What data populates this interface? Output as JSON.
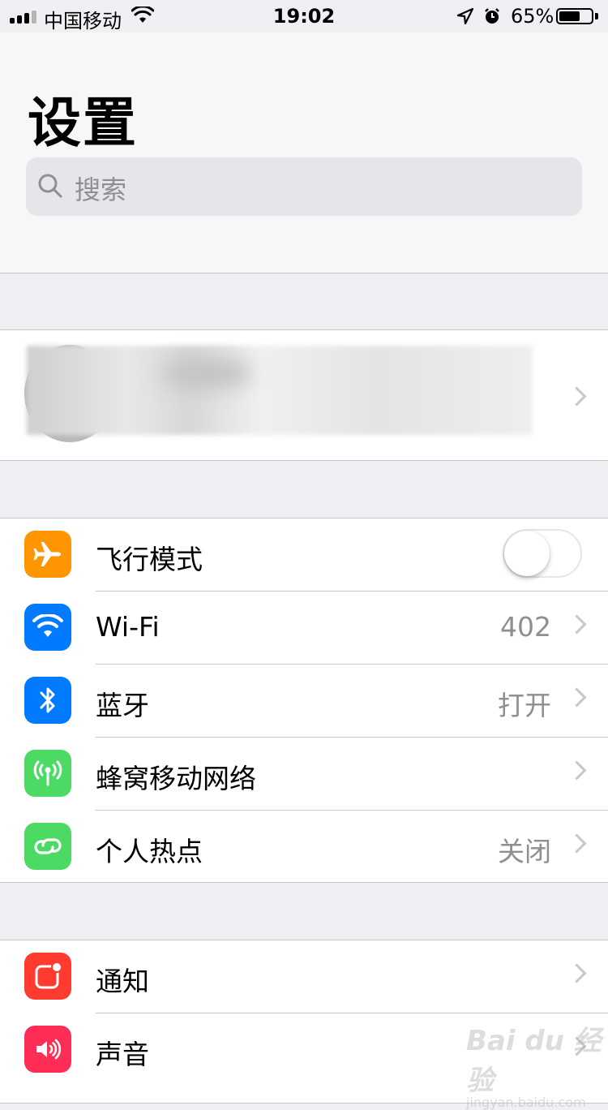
{
  "status_bar": {
    "carrier": "中国移动",
    "time": "19:02",
    "battery_percent": "65%",
    "battery_level": 0.65
  },
  "header": {
    "title": "设置",
    "search_placeholder": "搜索"
  },
  "groups": [
    {
      "rows": [
        {
          "label": "飞行模式",
          "icon": "airplane-icon",
          "color": "#ff9500",
          "toggle": false
        },
        {
          "label": "Wi-Fi",
          "icon": "wifi-icon",
          "color": "#007aff",
          "value": "402"
        },
        {
          "label": "蓝牙",
          "icon": "bluetooth-icon",
          "color": "#007aff",
          "value": "打开"
        },
        {
          "label": "蜂窝移动网络",
          "icon": "cellular-icon",
          "color": "#4cd964"
        },
        {
          "label": "个人热点",
          "icon": "hotspot-icon",
          "color": "#4cd964",
          "value": "关闭"
        }
      ]
    },
    {
      "rows": [
        {
          "label": "通知",
          "icon": "notifications-icon",
          "color": "#ff3b30"
        },
        {
          "label": "声音",
          "icon": "sounds-icon",
          "color": "#ff2d55"
        }
      ]
    }
  ],
  "watermark": {
    "text": "Bai du 经验",
    "url": "jingyan.baidu.com"
  }
}
